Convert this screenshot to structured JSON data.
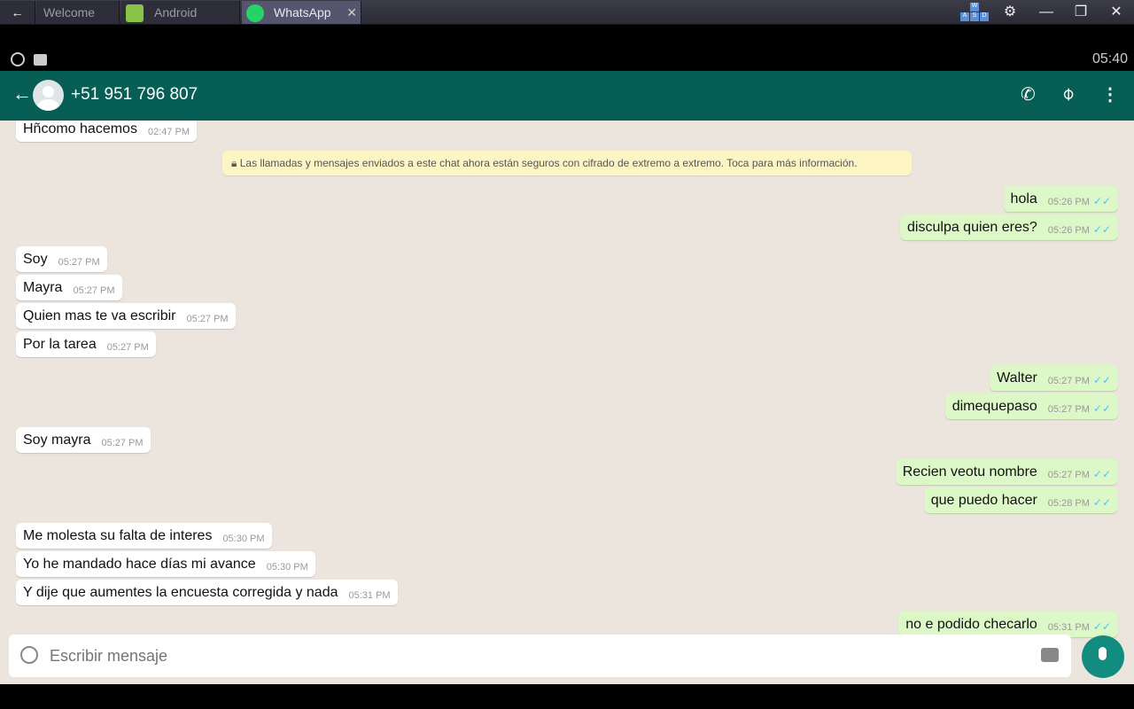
{
  "window": {
    "tabs": [
      {
        "label": "Welcome"
      },
      {
        "label": "Android"
      },
      {
        "label": "WhatsApp"
      }
    ],
    "wasd": [
      "W",
      "A",
      "S",
      "D"
    ]
  },
  "status": {
    "time": "05:40"
  },
  "header": {
    "contact": "+51 951 796 807"
  },
  "notice": "Las llamadas y mensajes enviados a este chat ahora están seguros con cifrado de extremo a extremo. Toca para más información.",
  "messages": [
    {
      "side": "in",
      "text": "Hñcomo hacemos",
      "time": "02:47 PM"
    },
    {
      "side": "out",
      "text": "hola",
      "time": "05:26 PM",
      "read": true
    },
    {
      "side": "out",
      "text": "disculpa quien eres?",
      "time": "05:26 PM",
      "read": true
    },
    {
      "side": "in",
      "text": "Soy",
      "time": "05:27 PM"
    },
    {
      "side": "in",
      "text": "Mayra",
      "time": "05:27 PM"
    },
    {
      "side": "in",
      "text": "Quien mas te va escribir",
      "time": "05:27 PM"
    },
    {
      "side": "in",
      "text": "Por la tarea",
      "time": "05:27 PM"
    },
    {
      "side": "out",
      "text": "Walter",
      "time": "05:27 PM",
      "read": true
    },
    {
      "side": "out",
      "text": "dimequepaso",
      "time": "05:27 PM",
      "read": true
    },
    {
      "side": "in",
      "text": "Soy mayra",
      "time": "05:27 PM"
    },
    {
      "side": "out",
      "text": "Recien veotu nombre",
      "time": "05:27 PM",
      "read": true
    },
    {
      "side": "out",
      "text": "que puedo hacer",
      "time": "05:28 PM",
      "read": true
    },
    {
      "side": "in",
      "text": "Me molesta su falta de interes",
      "time": "05:30 PM"
    },
    {
      "side": "in",
      "text": "Yo he mandado hace días mi avance",
      "time": "05:30 PM"
    },
    {
      "side": "in",
      "text": "Y dije que aumentes la encuesta corregida y nada",
      "time": "05:31 PM"
    },
    {
      "side": "out",
      "text": "no e podido  checarlo",
      "time": "05:31 PM",
      "read": true
    }
  ],
  "composer": {
    "placeholder": "Escribir mensaje"
  }
}
